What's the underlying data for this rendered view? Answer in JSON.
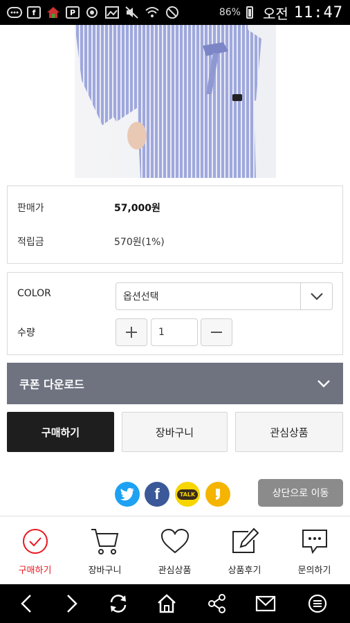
{
  "status_bar": {
    "battery": "86%",
    "ampm": "오전",
    "time": "11:47",
    "icons": [
      "chat-icon",
      "facebook-icon",
      "house-app-icon",
      "p-app-icon",
      "gear-app-icon",
      "photo-icon",
      "mute-icon",
      "wifi-icon",
      "block-icon"
    ]
  },
  "product_image": {
    "description_icon": "product-photo"
  },
  "price": {
    "sale_label": "판매가",
    "sale_value": "57,000원",
    "points_label": "적립금",
    "points_value": "570원(1%)"
  },
  "options": {
    "color_label": "COLOR",
    "color_value": "옵션선택",
    "qty_label": "수량",
    "qty_value": "1"
  },
  "coupon": {
    "label": "쿠폰 다운로드"
  },
  "actions": {
    "buy": "구매하기",
    "cart": "장바구니",
    "wish": "관심상품"
  },
  "social": {
    "kakao_text": "TALK",
    "top_button": "상단으로 이동"
  },
  "tabs": [
    {
      "label": "구매하기",
      "icon": "check-circle-icon"
    },
    {
      "label": "장바구니",
      "icon": "cart-icon"
    },
    {
      "label": "관심상품",
      "icon": "heart-icon"
    },
    {
      "label": "상품후기",
      "icon": "edit-icon"
    },
    {
      "label": "문의하기",
      "icon": "chat-bubble-icon"
    }
  ],
  "colors": {
    "accent": "#e8171f",
    "coupon_bg": "#6f7380",
    "primary_button": "#1e1e1e",
    "twitter": "#1da1f2",
    "facebook": "#3b5998",
    "kakao": "#f7d600",
    "kakaostory": "#f4b400"
  }
}
